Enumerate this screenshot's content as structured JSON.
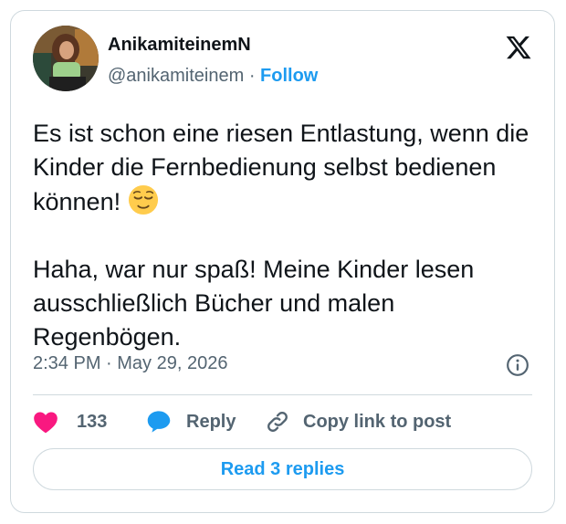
{
  "author": {
    "display_name": "AnikamiteinemN",
    "handle": "@anikamiteinem",
    "separator": "·",
    "follow_label": "Follow"
  },
  "tweet": {
    "line1": "Es ist schon eine riesen Entlastung, wenn die Kinder die Fernbedienung selbst bedienen können!",
    "emoji": "relieved-face",
    "line2": "Haha, war nur spaß! Meine Kinder lesen ausschließlich Bücher und malen Regenbögen.",
    "timestamp": "2:34 PM · May 29, 2026"
  },
  "actions": {
    "like_count": "133",
    "reply_label": "Reply",
    "copy_label": "Copy link to post"
  },
  "read_replies_label": "Read 3 replies",
  "colors": {
    "accent": "#1d9bf0",
    "like": "#f91880",
    "muted": "#536471",
    "border": "#cfd9de"
  }
}
